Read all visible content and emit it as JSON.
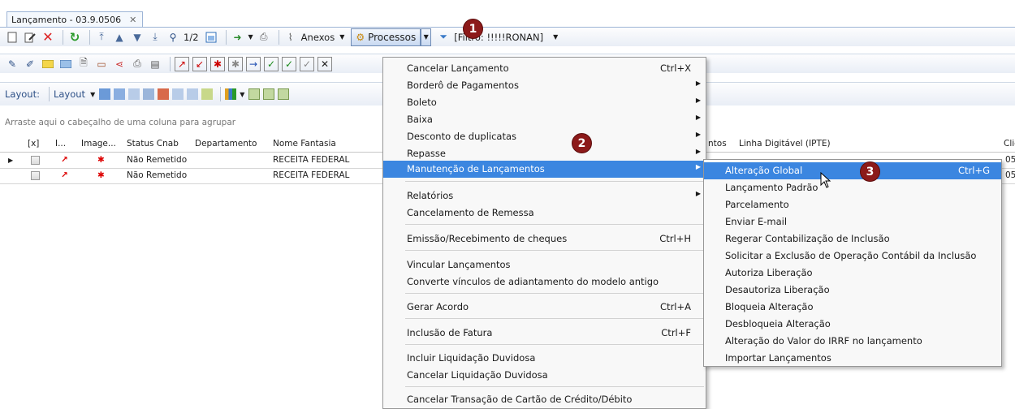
{
  "tab": {
    "title": "Lançamento - 03.9.0506",
    "close": "✕"
  },
  "toolbar1": {
    "page": "1/2",
    "anexos": "Anexos",
    "processos": "Processos",
    "filter": "[Filtro: !!!!!RONAN]"
  },
  "toolbar3": {
    "layout_label": "Layout:",
    "layout_btn": "Layout"
  },
  "grid": {
    "hint": "Arraste aqui o cabeçalho de uma coluna para agrupar",
    "headers": {
      "x": "[x]",
      "i": "I...",
      "image": "Image...",
      "status": "Status Cnab",
      "dept": "Departamento",
      "fantasia": "Nome Fantasia",
      "ntos": "ntos",
      "linha": "Linha Digitável (IPTE)",
      "cliente": "Cliente/"
    },
    "rows": [
      {
        "status": "Não Remetido",
        "fantasia": "RECEITA FEDERAL",
        "tail": "05"
      },
      {
        "status": "Não Remetido",
        "fantasia": "RECEITA FEDERAL",
        "tail": "05"
      }
    ]
  },
  "menu": {
    "items": [
      {
        "label": "Cancelar Lançamento",
        "shortcut": "Ctrl+X"
      },
      {
        "label": "Borderô de Pagamentos"
      },
      {
        "label": "Boleto"
      },
      {
        "label": "Baixa"
      },
      {
        "label": "Desconto de duplicatas"
      },
      {
        "label": "Repasse"
      },
      {
        "label": "Manutenção de Lançamentos"
      },
      {
        "label": "Relatórios"
      },
      {
        "label": "Cancelamento de Remessa"
      },
      {
        "label": "Emissão/Recebimento de cheques",
        "shortcut": "Ctrl+H"
      },
      {
        "label": "Vincular Lançamentos"
      },
      {
        "label": "Converte vínculos de adiantamento do modelo antigo"
      },
      {
        "label": "Gerar Acordo",
        "shortcut": "Ctrl+A"
      },
      {
        "label": "Inclusão de Fatura",
        "shortcut": "Ctrl+F"
      },
      {
        "label": "Incluir Liquidação Duvidosa"
      },
      {
        "label": "Cancelar Liquidação Duvidosa"
      },
      {
        "label": "Cancelar Transação de Cartão de Crédito/Débito"
      }
    ]
  },
  "submenu": {
    "items": [
      {
        "label": "Alteração Global",
        "shortcut": "Ctrl+G"
      },
      {
        "label": "Lançamento Padrão"
      },
      {
        "label": "Parcelamento"
      },
      {
        "label": "Enviar E-mail"
      },
      {
        "label": "Regerar Contabilização de Inclusão"
      },
      {
        "label": "Solicitar a Exclusão de Operação Contábil da Inclusão"
      },
      {
        "label": "Autoriza Liberação"
      },
      {
        "label": "Desautoriza Liberação"
      },
      {
        "label": "Bloqueia Alteração"
      },
      {
        "label": "Desbloqueia Alteração"
      },
      {
        "label": "Alteração do Valor do IRRF no lançamento"
      },
      {
        "label": "Importar Lançamentos"
      }
    ]
  },
  "badges": {
    "b1": "1",
    "b2": "2",
    "b3": "3"
  },
  "colors": {
    "highlight": "#3b86e0",
    "badge": "#8c1a1a"
  }
}
